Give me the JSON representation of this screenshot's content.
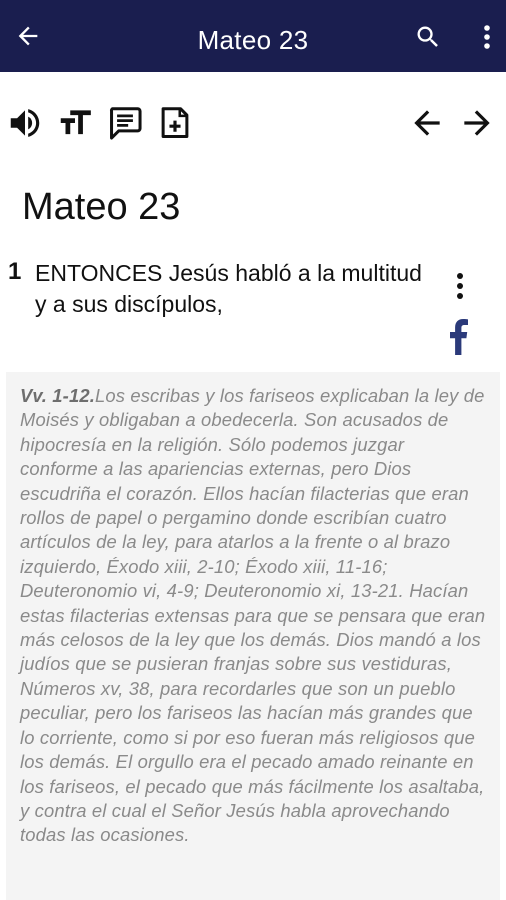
{
  "appbar": {
    "title": "Mateo 23",
    "back_icon": "arrow-left-icon",
    "search_icon": "search-icon",
    "more_icon": "more-vert-icon",
    "background": "#1a1e4f"
  },
  "toolbar": {
    "icons": [
      "speaker-icon",
      "text-size-icon",
      "comment-icon",
      "note-add-icon",
      "arrow-left-icon",
      "arrow-right-icon"
    ]
  },
  "chapter": {
    "title": "Mateo 23"
  },
  "verse": {
    "number": "1",
    "text": "ENTONCES Jesús habló a la multitud y a sus discípulos,"
  },
  "commentary": {
    "reference": "Vv. 1-12.",
    "text": "Los escribas y los fariseos explicaban la ley de Moisés y obligaban a obedecerla. Son acusados de hipocresía en la religión. Sólo podemos juzgar conforme a las apariencias externas, pero Dios escudriña el corazón. Ellos hacían filacterias que eran rollos de papel o pergamino donde escribían cuatro artículos de la ley, para atarlos a la frente o al brazo izquierdo, Éxodo xiii, 2-10; Éxodo xiii, 11-16; Deuteronomio vi, 4-9; Deuteronomio xi, 13-21. Hacían estas filacterias extensas para que se pensara que eran más celosos de la ley que los demás. Dios mandó a los judíos que se pusieran franjas sobre sus vestiduras, Números xv, 38, para recordarles que son un pueblo peculiar, pero los fariseos las hacían más grandes que lo corriente, como si por eso fueran más religiosos que los demás. El orgullo era el pecado amado reinante en los fariseos, el pecado que más fácilmente los asaltaba, y contra el cual el Señor Jesús habla aprovechando todas las ocasiones."
  }
}
